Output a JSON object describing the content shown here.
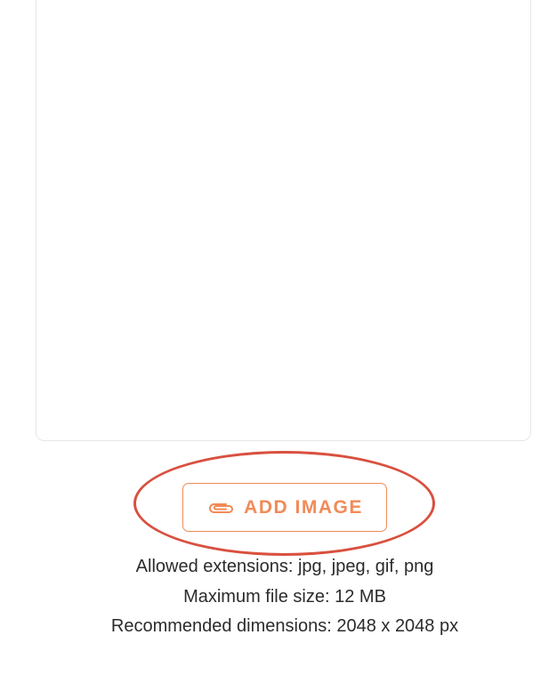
{
  "upload": {
    "button_label": "ADD IMAGE",
    "button_icon": "paperclip-icon",
    "accent_color": "#f28a57",
    "highlight_color": "#d9503f",
    "allowed_extensions": "Allowed extensions: jpg, jpeg, gif, png",
    "max_file_size": "Maximum file size: 12 MB",
    "recommended_dimensions": "Recommended dimensions: 2048 x 2048 px"
  }
}
